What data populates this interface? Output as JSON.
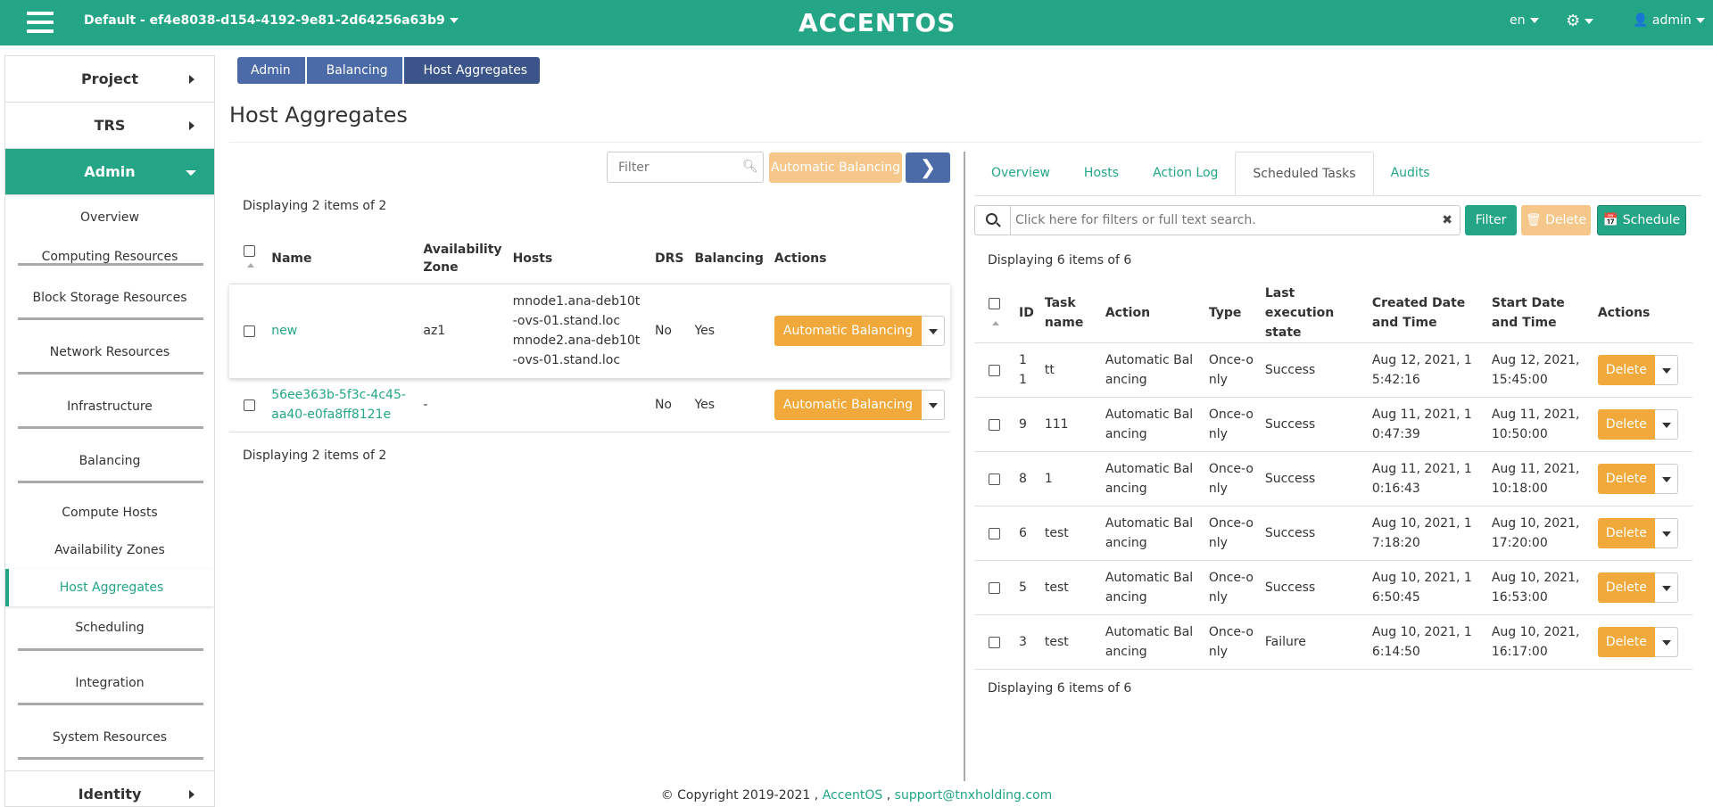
{
  "topbar": {
    "project": "Default - ef4e8038-d154-4192-9e81-2d64256a63b9",
    "brand": "ACCENTOS",
    "lang": "en",
    "user": "admin"
  },
  "sidebar": {
    "project": "Project",
    "trs": "TRS",
    "admin": "Admin",
    "overview": "Overview",
    "computing": "Computing Resources",
    "block_storage": "Block Storage Resources",
    "network": "Network Resources",
    "infrastructure": "Infrastructure",
    "balancing": "Balancing",
    "compute_hosts": "Compute Hosts",
    "availability_zones": "Availability Zones",
    "host_aggregates": "Host Aggregates",
    "scheduling": "Scheduling",
    "integration": "Integration",
    "system_resources": "System Resources",
    "identity": "Identity"
  },
  "breadcrumb": [
    "Admin",
    "Balancing",
    "Host Aggregates"
  ],
  "page_title": "Host Aggregates",
  "left": {
    "filter_placeholder": "Filter",
    "auto_balancing_btn": "Automatic Balancing",
    "displaying_top": "Displaying 2 items of 2",
    "displaying_bottom": "Displaying 2 items of 2",
    "headers": {
      "name": "Name",
      "az": "Availability Zone",
      "hosts": "Hosts",
      "drs": "DRS",
      "balancing": "Balancing",
      "actions": "Actions"
    },
    "rows": [
      {
        "name": "new",
        "az": "az1",
        "hosts1": "mnode1.ana-deb10t-ovs-01.stand.loc",
        "hosts2": "mnode2.ana-deb10t-ovs-01.stand.loc",
        "drs": "No",
        "balancing": "Yes",
        "action": "Automatic Balancing"
      },
      {
        "name": "56ee363b-5f3c-4c45-aa40-e0fa8ff8121e",
        "az": "-",
        "drs": "No",
        "balancing": "Yes",
        "action": "Automatic Balancing"
      }
    ]
  },
  "right": {
    "tabs": [
      "Overview",
      "Hosts",
      "Action Log",
      "Scheduled Tasks",
      "Audits"
    ],
    "search_placeholder": "Click here for filters or full text search.",
    "filter_btn": "Filter",
    "delete_btn": "Delete",
    "schedule_btn": "Schedule",
    "displaying_top": "Displaying 6 items of 6",
    "displaying_bottom": "Displaying 6 items of 6",
    "headers": {
      "id": "ID",
      "task": "Task name",
      "action": "Action",
      "type": "Type",
      "state": "Last execution state",
      "created": "Created Date and Time",
      "start": "Start Date and Time",
      "actions": "Actions"
    },
    "rows": [
      {
        "id": "11",
        "task": "tt",
        "action": "Automatic Balancing",
        "type": "Once-only",
        "state": "Success",
        "created": "Aug 12, 2021, 15:42:16",
        "start": "Aug 12, 2021, 15:45:00",
        "btn": "Delete"
      },
      {
        "id": "9",
        "task": "111",
        "action": "Automatic Balancing",
        "type": "Once-only",
        "state": "Success",
        "created": "Aug 11, 2021, 10:47:39",
        "start": "Aug 11, 2021, 10:50:00",
        "btn": "Delete"
      },
      {
        "id": "8",
        "task": "1",
        "action": "Automatic Balancing",
        "type": "Once-only",
        "state": "Success",
        "created": "Aug 11, 2021, 10:16:43",
        "start": "Aug 11, 2021, 10:18:00",
        "btn": "Delete"
      },
      {
        "id": "6",
        "task": "test",
        "action": "Automatic Balancing",
        "type": "Once-only",
        "state": "Success",
        "created": "Aug 10, 2021, 17:18:20",
        "start": "Aug 10, 2021, 17:20:00",
        "btn": "Delete"
      },
      {
        "id": "5",
        "task": "test",
        "action": "Automatic Balancing",
        "type": "Once-only",
        "state": "Success",
        "created": "Aug 10, 2021, 16:50:45",
        "start": "Aug 10, 2021, 16:53:00",
        "btn": "Delete"
      },
      {
        "id": "3",
        "task": "test",
        "action": "Automatic Balancing",
        "type": "Once-only",
        "state": "Failure",
        "created": "Aug 10, 2021, 16:14:50",
        "start": "Aug 10, 2021, 16:17:00",
        "btn": "Delete"
      }
    ]
  },
  "footer": {
    "copyright": "© Copyright 2019-2021 ,",
    "brand_link": "AccentOS",
    "sep": ",",
    "email": "support@tnxholding.com"
  }
}
